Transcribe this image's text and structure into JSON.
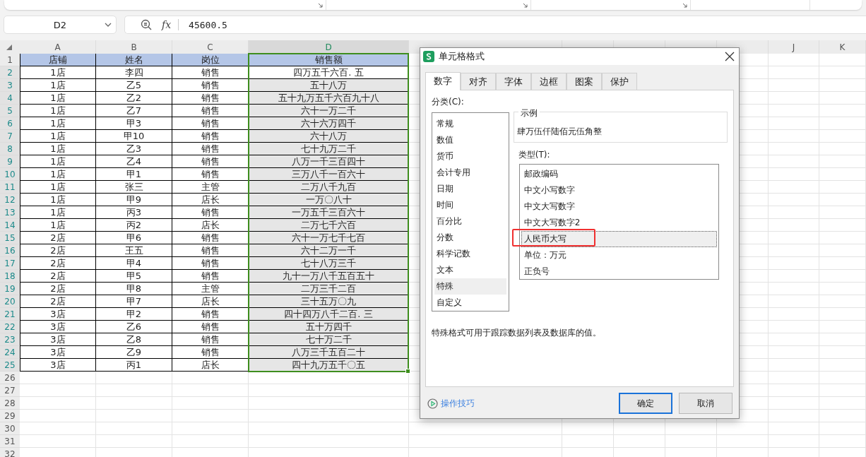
{
  "name_box": {
    "value": "D2"
  },
  "formula_bar": {
    "function_symbol": "fx",
    "value": "45600.5"
  },
  "sheet": {
    "columns": [
      {
        "label": "A",
        "selected": false
      },
      {
        "label": "B",
        "selected": false
      },
      {
        "label": "C",
        "selected": false
      },
      {
        "label": "D",
        "selected": true
      },
      {
        "selected": false
      },
      {
        "selected": false
      },
      {
        "selected": false
      },
      {
        "selected": false
      },
      {
        "selected": false
      },
      {
        "label": "J",
        "selected": false
      },
      {
        "label": "K",
        "selected": false
      }
    ],
    "rows": [
      {
        "number": "1",
        "kind": "header",
        "selected": false,
        "cells": [
          "店铺",
          "姓名",
          "岗位",
          "销售额"
        ]
      },
      {
        "number": "2",
        "kind": "data",
        "selected": true,
        "active": true,
        "cells": [
          "1店",
          "李四",
          "销售",
          "四万五千六百. 五"
        ]
      },
      {
        "number": "3",
        "kind": "data",
        "selected": true,
        "active": false,
        "cells": [
          "1店",
          "乙5",
          "销售",
          "五十八万"
        ]
      },
      {
        "number": "4",
        "kind": "data",
        "selected": true,
        "active": false,
        "cells": [
          "1店",
          "乙2",
          "销售",
          "五十九万五千六百九十八"
        ]
      },
      {
        "number": "5",
        "kind": "data",
        "selected": true,
        "active": false,
        "cells": [
          "1店",
          "乙7",
          "销售",
          "六十一万二千"
        ]
      },
      {
        "number": "6",
        "kind": "data",
        "selected": true,
        "active": false,
        "cells": [
          "1店",
          "甲3",
          "销售",
          "六十六万四千"
        ]
      },
      {
        "number": "7",
        "kind": "data",
        "selected": true,
        "active": false,
        "cells": [
          "1店",
          "甲10",
          "销售",
          "六十八万"
        ]
      },
      {
        "number": "8",
        "kind": "data",
        "selected": true,
        "active": false,
        "cells": [
          "1店",
          "乙3",
          "销售",
          "七十九万二千"
        ]
      },
      {
        "number": "9",
        "kind": "data",
        "selected": true,
        "active": false,
        "cells": [
          "1店",
          "乙4",
          "销售",
          "八万一千三百四十"
        ]
      },
      {
        "number": "10",
        "kind": "data",
        "selected": true,
        "active": false,
        "cells": [
          "1店",
          "甲1",
          "销售",
          "三万八千一百六十"
        ]
      },
      {
        "number": "11",
        "kind": "data",
        "selected": true,
        "active": false,
        "cells": [
          "1店",
          "张三",
          "主管",
          "二万八千九百"
        ]
      },
      {
        "number": "12",
        "kind": "data",
        "selected": true,
        "active": false,
        "cells": [
          "1店",
          "甲9",
          "店长",
          "一万〇八十"
        ]
      },
      {
        "number": "13",
        "kind": "data",
        "selected": true,
        "active": false,
        "cells": [
          "1店",
          "丙3",
          "销售",
          "一万五千三百六十"
        ]
      },
      {
        "number": "14",
        "kind": "data",
        "selected": true,
        "active": false,
        "cells": [
          "1店",
          "丙2",
          "店长",
          "二万七千六百"
        ]
      },
      {
        "number": "15",
        "kind": "data",
        "selected": true,
        "active": false,
        "cells": [
          "2店",
          "甲6",
          "销售",
          "六十一万七千七百"
        ]
      },
      {
        "number": "16",
        "kind": "data",
        "selected": true,
        "active": false,
        "cells": [
          "2店",
          "王五",
          "销售",
          "六十二万一千"
        ]
      },
      {
        "number": "17",
        "kind": "data",
        "selected": true,
        "active": false,
        "cells": [
          "2店",
          "甲4",
          "销售",
          "七十八万三千"
        ]
      },
      {
        "number": "18",
        "kind": "data",
        "selected": true,
        "active": false,
        "cells": [
          "2店",
          "甲5",
          "销售",
          "九十一万八千五百五十"
        ]
      },
      {
        "number": "19",
        "kind": "data",
        "selected": true,
        "active": false,
        "cells": [
          "2店",
          "甲8",
          "主管",
          "二万三千二百"
        ]
      },
      {
        "number": "20",
        "kind": "data",
        "selected": true,
        "active": false,
        "cells": [
          "2店",
          "甲7",
          "店长",
          "三十五万〇九"
        ]
      },
      {
        "number": "21",
        "kind": "data",
        "selected": true,
        "active": false,
        "cells": [
          "3店",
          "甲2",
          "销售",
          "四十四万八千二百. 三"
        ]
      },
      {
        "number": "22",
        "kind": "data",
        "selected": true,
        "active": false,
        "cells": [
          "3店",
          "乙6",
          "销售",
          "五十万四千"
        ]
      },
      {
        "number": "23",
        "kind": "data",
        "selected": true,
        "active": false,
        "cells": [
          "3店",
          "乙8",
          "销售",
          "七十万二千"
        ]
      },
      {
        "number": "24",
        "kind": "data",
        "selected": true,
        "active": false,
        "cells": [
          "3店",
          "乙9",
          "销售",
          "八万三千五百二十"
        ]
      },
      {
        "number": "25",
        "kind": "data",
        "selected": true,
        "active": false,
        "cells": [
          "3店",
          "丙1",
          "店长",
          "四十九万五千〇五"
        ]
      },
      {
        "number": "26",
        "selected": false
      },
      {
        "number": "27",
        "selected": false
      },
      {
        "number": "28",
        "selected": false
      },
      {
        "number": "29",
        "selected": false
      },
      {
        "number": "30",
        "selected": false
      },
      {
        "number": "31",
        "selected": false
      },
      {
        "number": "32",
        "selected": false
      }
    ]
  },
  "dialog": {
    "title": "单元格格式",
    "tabs": [
      {
        "label": "数字",
        "selected": true
      },
      {
        "label": "对齐",
        "selected": false
      },
      {
        "label": "字体",
        "selected": false
      },
      {
        "label": "边框",
        "selected": false
      },
      {
        "label": "图案",
        "selected": false
      },
      {
        "label": "保护",
        "selected": false
      }
    ],
    "category_label": "分类(C):",
    "categories": [
      {
        "label": "常规",
        "selected": false
      },
      {
        "label": "数值",
        "selected": false
      },
      {
        "label": "货币",
        "selected": false
      },
      {
        "label": "会计专用",
        "selected": false
      },
      {
        "label": "日期",
        "selected": false
      },
      {
        "label": "时间",
        "selected": false
      },
      {
        "label": "百分比",
        "selected": false
      },
      {
        "label": "分数",
        "selected": false
      },
      {
        "label": "科学记数",
        "selected": false
      },
      {
        "label": "文本",
        "selected": false
      },
      {
        "label": "特殊",
        "selected": true
      },
      {
        "label": "自定义",
        "selected": false
      }
    ],
    "sample_label": "示例",
    "sample_value": "肆万伍仟陆佰元伍角整",
    "type_label": "类型(T):",
    "types": [
      {
        "label": "邮政编码",
        "selected": false,
        "marked": false
      },
      {
        "label": "中文小写数字",
        "selected": false,
        "marked": false
      },
      {
        "label": "中文大写数字",
        "selected": false,
        "marked": false
      },
      {
        "label": "中文大写数字2",
        "selected": false,
        "marked": false
      },
      {
        "label": "人民币大写",
        "selected": true,
        "marked": true
      },
      {
        "label": "单位：万元",
        "selected": false,
        "marked": false
      },
      {
        "label": "正负号",
        "selected": false,
        "marked": false
      }
    ],
    "description": "特殊格式可用于跟踪数据列表及数据库的值。",
    "tips_link": "操作技巧",
    "buttons": [
      {
        "label": "确定",
        "default": true
      },
      {
        "label": "取消",
        "default": false
      }
    ]
  }
}
